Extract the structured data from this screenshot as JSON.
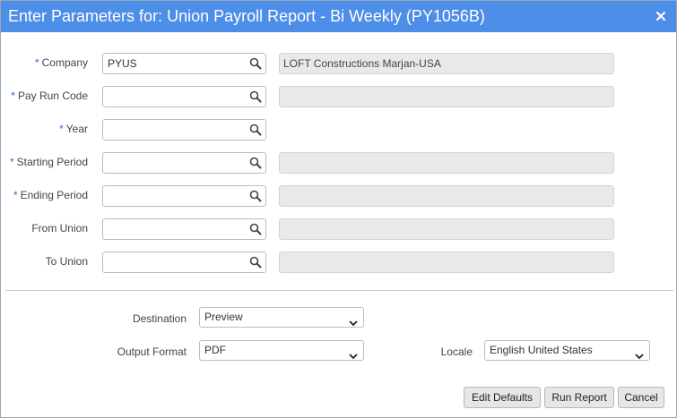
{
  "dialog": {
    "title": "Enter Parameters for: Union Payroll Report - Bi Weekly (PY1056B)",
    "close_icon": "close-icon"
  },
  "colors": {
    "titlebar": "#4d8ee8",
    "required_marker": "#2a6bd2",
    "readonly_bg": "#e9e9e9",
    "button_bg": "#e6e6e6"
  },
  "required_marker": "*",
  "fields": {
    "company": {
      "label": "Company",
      "required": true,
      "value": "PYUS",
      "description": "LOFT Constructions Marjan-USA"
    },
    "pay_run_code": {
      "label": "Pay Run Code",
      "required": true,
      "value": "",
      "description": ""
    },
    "year": {
      "label": "Year",
      "required": true,
      "value": ""
    },
    "starting_period": {
      "label": "Starting Period",
      "required": true,
      "value": "",
      "description": ""
    },
    "ending_period": {
      "label": "Ending Period",
      "required": true,
      "value": "",
      "description": ""
    },
    "from_union": {
      "label": "From Union",
      "required": false,
      "value": "",
      "description": ""
    },
    "to_union": {
      "label": "To Union",
      "required": false,
      "value": "",
      "description": ""
    }
  },
  "output": {
    "destination_label": "Destination",
    "destination_value": "Preview",
    "format_label": "Output Format",
    "format_value": "PDF",
    "locale_label": "Locale",
    "locale_value": "English United States"
  },
  "buttons": {
    "edit_defaults": "Edit Defaults",
    "run_report": "Run Report",
    "cancel": "Cancel"
  }
}
